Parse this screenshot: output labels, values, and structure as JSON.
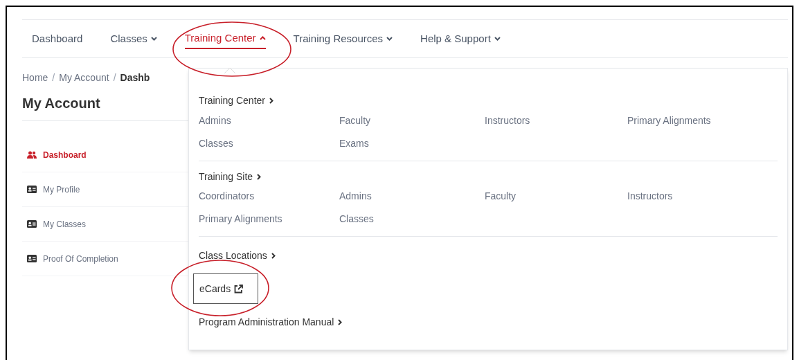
{
  "nav": [
    {
      "label": "Dashboard",
      "kind": "link",
      "selected": false
    },
    {
      "label": "Classes",
      "kind": "dropdown",
      "expanded": false,
      "selected": false
    },
    {
      "label": "Training Center",
      "kind": "dropdown",
      "expanded": true,
      "selected": true
    },
    {
      "label": "Training Resources",
      "kind": "dropdown",
      "expanded": false,
      "selected": false
    },
    {
      "label": "Help & Support",
      "kind": "dropdown",
      "expanded": false,
      "selected": false
    }
  ],
  "breadcrumb": [
    {
      "kind": "link",
      "text": "Home"
    },
    {
      "kind": "separator",
      "text": "/"
    },
    {
      "kind": "link",
      "text": "My Account"
    },
    {
      "kind": "separator",
      "text": "/"
    },
    {
      "kind": "current",
      "text": "Dashb"
    }
  ],
  "page_title": "My Account",
  "sidebar": {
    "items": [
      {
        "label": "Dashboard",
        "selected": true
      },
      {
        "label": "My Profile",
        "selected": false
      },
      {
        "label": "My Classes",
        "selected": false
      },
      {
        "label": "Proof Of Completion",
        "selected": false
      }
    ]
  },
  "menu": {
    "sections": [
      {
        "kind": "group",
        "heading": "Training Center",
        "rows": [
          [
            "Admins",
            "Faculty",
            "Instructors",
            "Primary Alignments"
          ],
          [
            "Classes",
            "Exams"
          ]
        ]
      },
      {
        "kind": "group",
        "heading": "Training Site",
        "rows": [
          [
            "Coordinators",
            "Admins",
            "Faculty",
            "Instructors"
          ],
          [
            "Primary Alignments",
            "Classes"
          ]
        ]
      },
      {
        "kind": "link",
        "heading": "Class Locations"
      },
      {
        "kind": "external",
        "label": "eCards",
        "highlighted": true
      },
      {
        "kind": "link",
        "heading": "Program Administration Manual"
      }
    ]
  }
}
